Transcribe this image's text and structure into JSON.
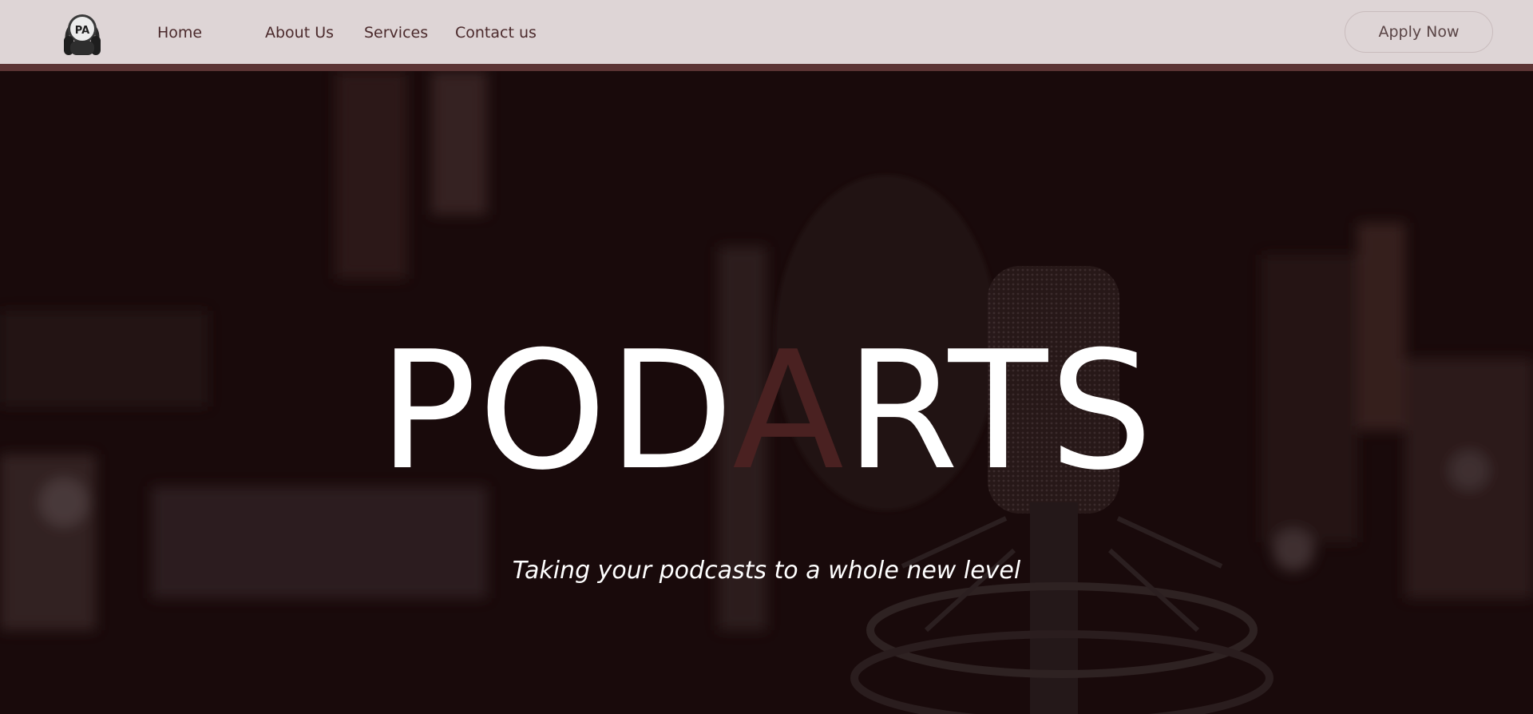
{
  "nav": {
    "home": "Home",
    "about": "About Us",
    "services": "Services",
    "contact": "Contact us"
  },
  "header": {
    "apply_label": "Apply Now",
    "logo_text": "PA",
    "logo_icon": "headphones-icon"
  },
  "hero": {
    "title_part1": "POD",
    "title_accent": "A",
    "title_part2": "RTS",
    "tagline": "Taking your podcasts to a whole new level",
    "background": "microphone-studio-image"
  },
  "colors": {
    "header_bg": "#ded5d6",
    "header_border": "#5b3434",
    "nav_text": "#4b2a2c",
    "hero_bg": "#1b0b0c",
    "title_accent": "#4a2121",
    "title": "#ffffff"
  }
}
